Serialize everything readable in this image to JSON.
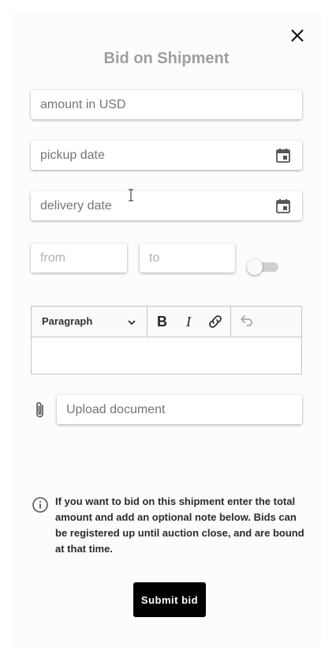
{
  "dialog": {
    "title": "Bid on Shipment",
    "close_icon": "close-icon"
  },
  "form": {
    "amount_placeholder": "amount in USD",
    "pickup_placeholder": "pickup date",
    "delivery_placeholder": "delivery date",
    "from_placeholder": "from",
    "to_placeholder": "to",
    "toggle_state": "off",
    "calendar_icon": "calendar-icon"
  },
  "editor": {
    "heading_value": "Paragraph",
    "bold_label": "B",
    "italic_label": "I",
    "toolbar_icons": [
      "chevron-down-icon",
      "link-icon",
      "undo-icon"
    ]
  },
  "upload": {
    "placeholder": "Upload document",
    "icon": "paperclip-icon"
  },
  "info": {
    "icon": "info-icon",
    "text": "If you want to bid on this shipment enter the total amount and add an optional note below. Bids can be registered up until auction close, and are bound at that time."
  },
  "actions": {
    "submit_label": "Submit bid"
  },
  "colors": {
    "title": "#9e9e9e",
    "button_bg": "#000000",
    "dialog_bg": "#fcfcfb"
  }
}
